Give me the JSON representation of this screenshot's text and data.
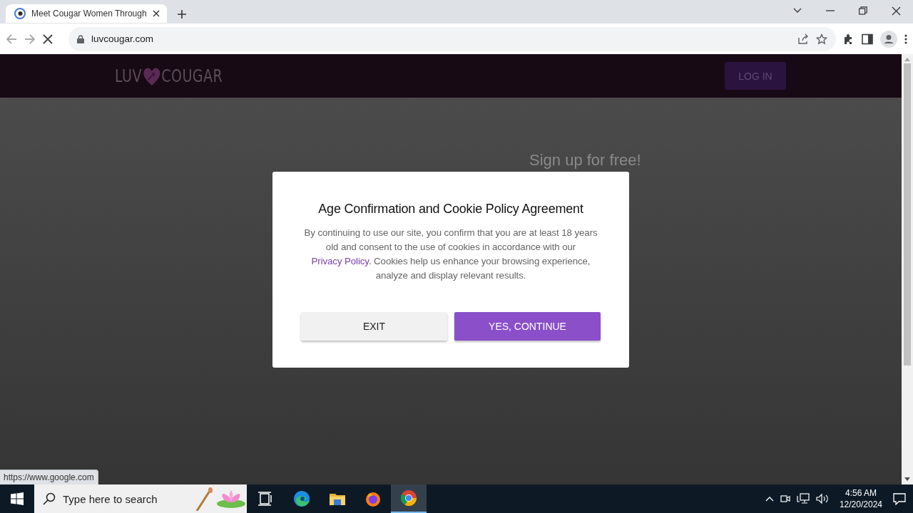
{
  "browser": {
    "tabs": [
      {
        "title": "Meet Cougar Women Through",
        "selected": true
      }
    ],
    "url": "luvcougar.com",
    "loading": true,
    "status_url": "https://www.google.com"
  },
  "site": {
    "logo_left": "LUV",
    "logo_right": "COUGAR",
    "login_button": "LOG IN",
    "signup_heading": "Sign up for free!"
  },
  "modal": {
    "title": "Age Confirmation and Cookie Policy Agreement",
    "body_before": "By continuing to use our site, you confirm that you are at least 18 years old and consent to the use of cookies in accordance with our ",
    "link": "Privacy Policy",
    "body_after": ". Cookies help us enhance your browsing experience, analyze and display relevant results.",
    "buttons": [
      {
        "label": "EXIT",
        "kind": "secondary"
      },
      {
        "label": "YES, CONTINUE",
        "kind": "primary"
      }
    ]
  },
  "taskbar": {
    "search_placeholder": "Type here to search",
    "apps": [
      {
        "kind": "taskview",
        "selected": false
      },
      {
        "kind": "edge",
        "selected": false
      },
      {
        "kind": "folder",
        "selected": false
      },
      {
        "kind": "firefox",
        "selected": false
      },
      {
        "kind": "chrome",
        "selected": true
      }
    ],
    "time": "4:56 AM",
    "date": "12/20/2024"
  }
}
